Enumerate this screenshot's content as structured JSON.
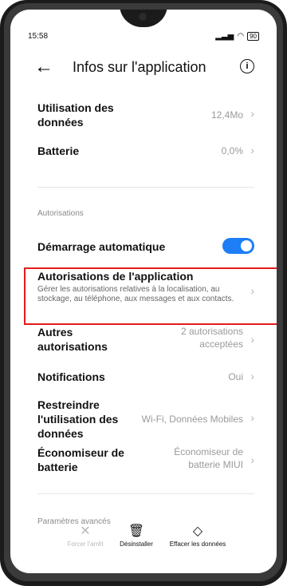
{
  "status": {
    "time": "15:58",
    "battery": "90"
  },
  "header": {
    "title": "Infos sur l'application"
  },
  "rows": {
    "data_usage": {
      "label": "Utilisation des données",
      "value": "12,4Mo"
    },
    "battery": {
      "label": "Batterie",
      "value": "0,0%"
    },
    "autostart": {
      "label": "Démarrage automatique",
      "toggle_on": true
    },
    "permissions": {
      "label": "Autorisations de l'application",
      "desc": "Gérer les autorisations relatives à la localisation, au stockage, au téléphone, aux messages et aux contacts."
    },
    "other_perms": {
      "label": "Autres autorisations",
      "value": "2 autorisations acceptées"
    },
    "notifications": {
      "label": "Notifications",
      "value": "Oui"
    },
    "restrict": {
      "label": "Restreindre l'utilisation des données",
      "value": "Wi-Fi, Données Mobiles"
    },
    "saver": {
      "label": "Économiseur de batterie",
      "value": "Économiseur de batterie MIUI"
    }
  },
  "sections": {
    "autorisations": "Autorisations",
    "advanced": "Paramètres avancés"
  },
  "bottom": {
    "force_stop": "Forcer l'arrêt",
    "uninstall": "Désinstaller",
    "clear": "Effacer les données"
  },
  "colors": {
    "accent": "#1e7ef8",
    "highlight": "#e51a1a"
  }
}
